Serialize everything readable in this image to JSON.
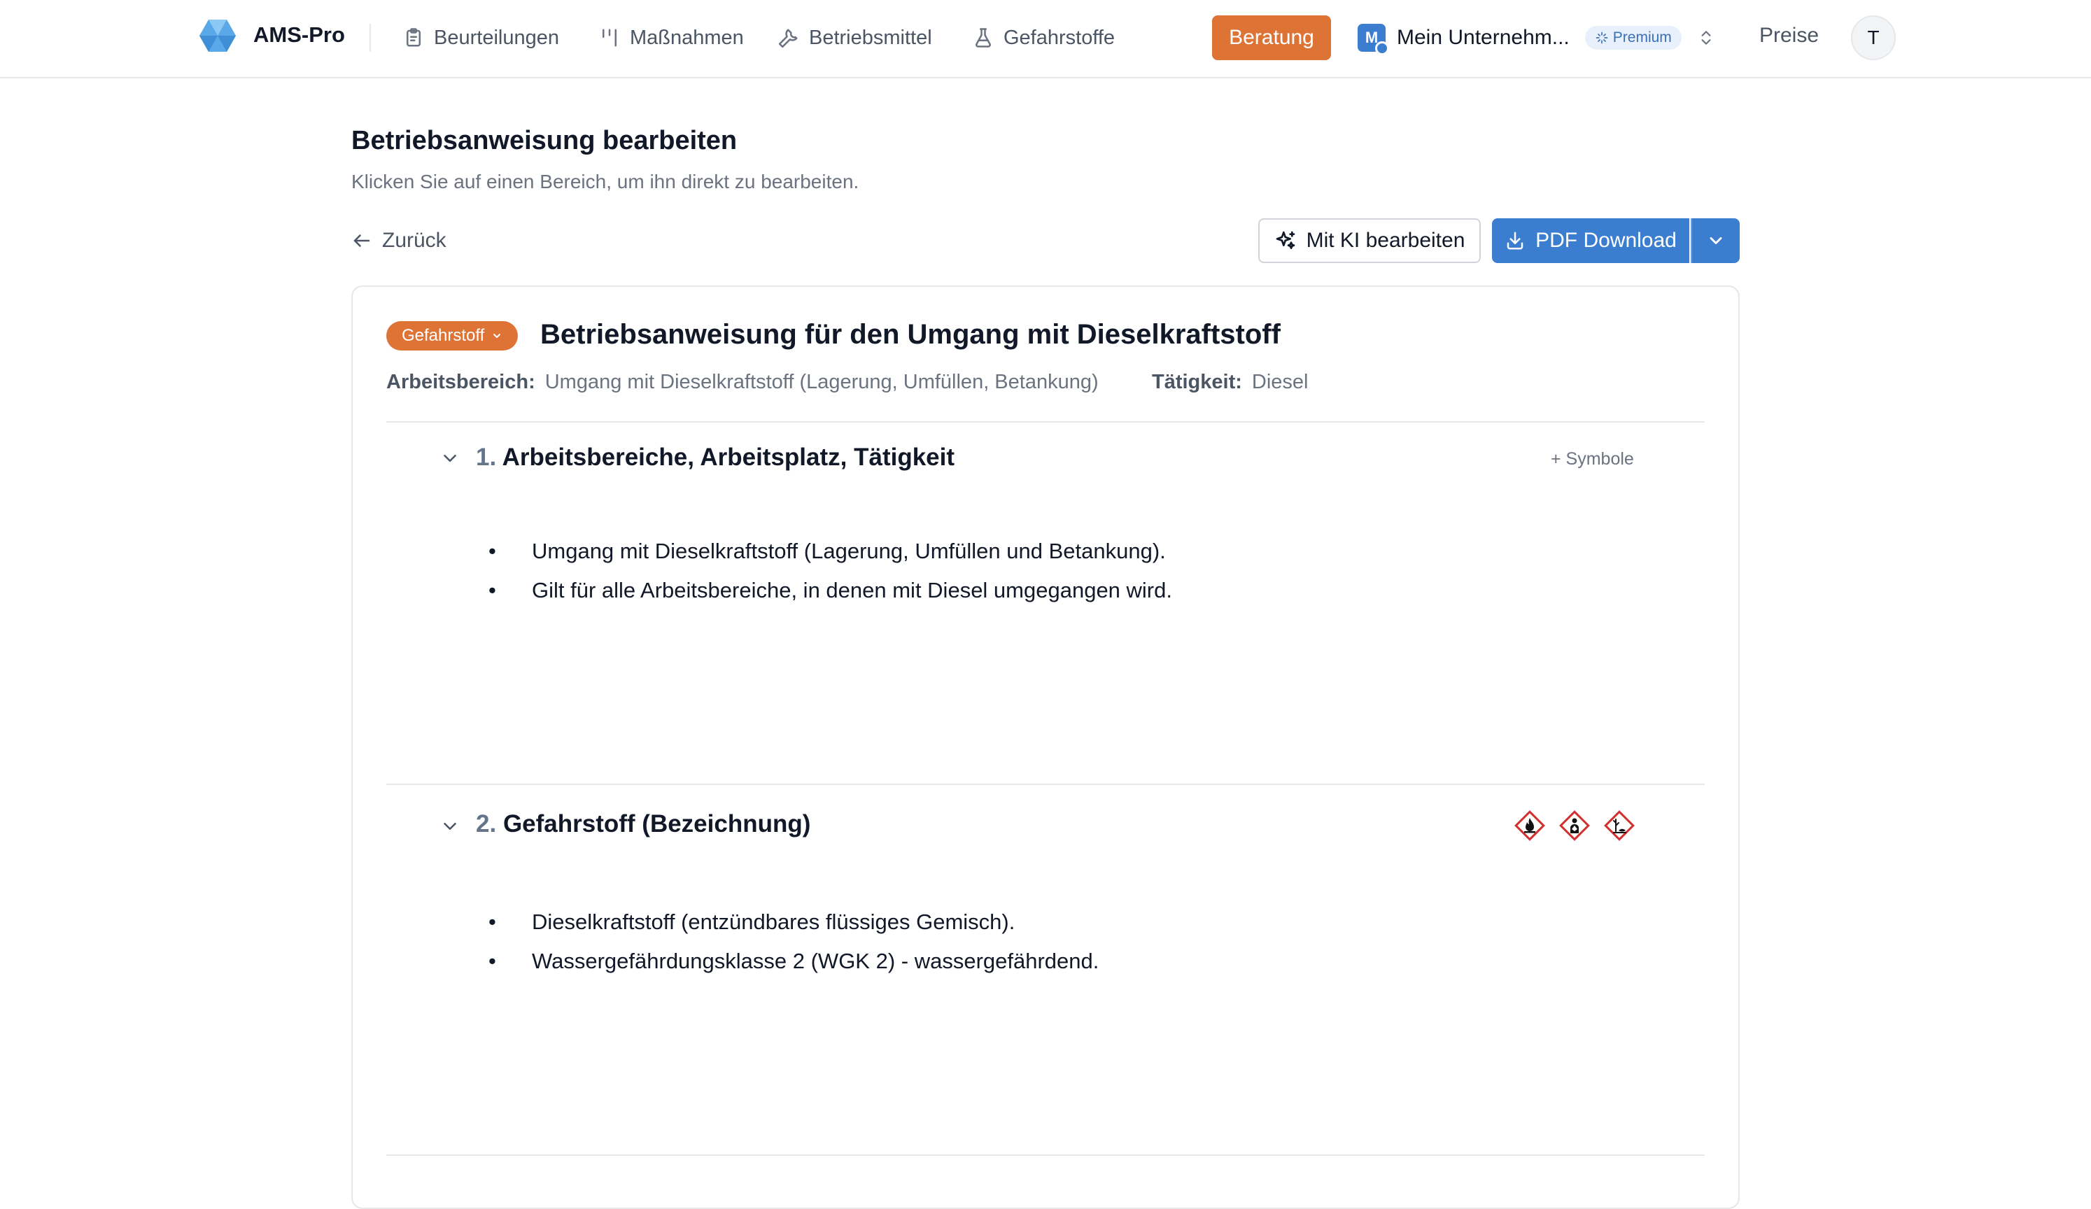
{
  "app": {
    "brand": "AMS-Pro",
    "nav": [
      {
        "label": "Beurteilungen",
        "icon": "clipboard-icon"
      },
      {
        "label": "Maßnahmen",
        "icon": "bars-icon"
      },
      {
        "label": "Betriebsmittel",
        "icon": "wrench-icon"
      },
      {
        "label": "Gefahrstoffe",
        "icon": "flask-icon"
      }
    ],
    "beratung_label": "Beratung",
    "company": {
      "initial": "M",
      "name": "Mein Unternehm...",
      "plan": "Premium"
    },
    "preise_label": "Preise",
    "user_initial": "T"
  },
  "page": {
    "title": "Betriebsanweisung bearbeiten",
    "subtitle": "Klicken Sie auf einen Bereich, um ihn direkt zu bearbeiten.",
    "back_label": "Zurück",
    "ki_label": "Mit KI bearbeiten",
    "pdf_label": "PDF Download"
  },
  "document": {
    "type_badge": "Gefahrstoff",
    "title": "Betriebsanweisung für den Umgang mit Dieselkraftstoff",
    "arbeitsbereich_label": "Arbeitsbereich:",
    "arbeitsbereich_value": "Umgang mit Dieselkraftstoff (Lagerung, Umfüllen, Betankung)",
    "taetigkeit_label": "Tätigkeit:",
    "taetigkeit_value": "Diesel",
    "sections": [
      {
        "number": "1.",
        "title": "Arbeitsbereiche, Arbeitsplatz, Tätigkeit",
        "action": "+ Symbole",
        "items": [
          "Umgang mit Dieselkraftstoff (Lagerung, Umfüllen und Betankung).",
          "Gilt für alle Arbeitsbereiche, in denen mit Diesel umgegangen wird."
        ]
      },
      {
        "number": "2.",
        "title": "Gefahrstoff (Bezeichnung)",
        "symbols": [
          "flame-pictogram-icon",
          "health-hazard-pictogram-icon",
          "environment-pictogram-icon"
        ],
        "items": [
          "Dieselkraftstoff (entzündbares flüssiges Gemisch).",
          "Wassergefährdungsklasse 2 (WGK 2) - wassergefährdend."
        ]
      }
    ]
  },
  "colors": {
    "accent_orange": "#dd7436",
    "primary_blue": "#3b7ed0",
    "ghs_red": "#d32f2f"
  }
}
